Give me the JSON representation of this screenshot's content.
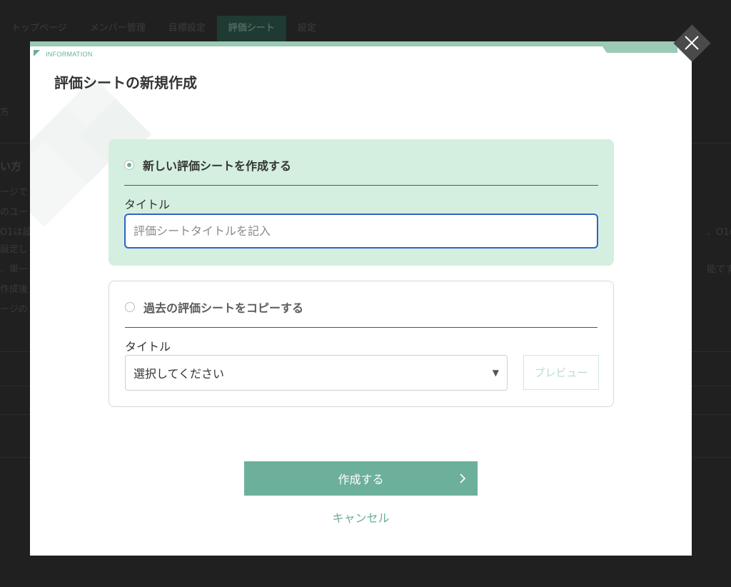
{
  "background": {
    "tabs": [
      "トップページ",
      "メンバー管理",
      "目標設定",
      "評価シート",
      "設定"
    ],
    "active_tab_index": 3,
    "fragments_left": [
      "方",
      "い方",
      "ージで",
      "のユー",
      "O1は設",
      "設定し",
      "、単一",
      "作成後",
      "ージの"
    ],
    "fragments_right": [
      "、O1の",
      "能です。"
    ]
  },
  "modal": {
    "header_label": "INFORMATION",
    "title": "評価シートの新規作成",
    "new_option": {
      "label": "新しい評価シートを作成する",
      "selected": true,
      "field_label": "タイトル",
      "input_value": "",
      "input_placeholder": "評価シートタイトルを記入"
    },
    "copy_option": {
      "label": "過去の評価シートをコピーする",
      "selected": false,
      "field_label": "タイトル",
      "select_value": "選択してください",
      "preview_label": "プレビュー"
    },
    "create_label": "作成する",
    "cancel_label": "キャンセル"
  },
  "colors": {
    "accent": "#6cb09b",
    "panel_bg": "#d4efe0",
    "input_focus": "#2f62c9"
  },
  "icons": {
    "close": "close-icon",
    "chevron": "chevron-right-icon",
    "dropdown": "caret-down-icon"
  }
}
